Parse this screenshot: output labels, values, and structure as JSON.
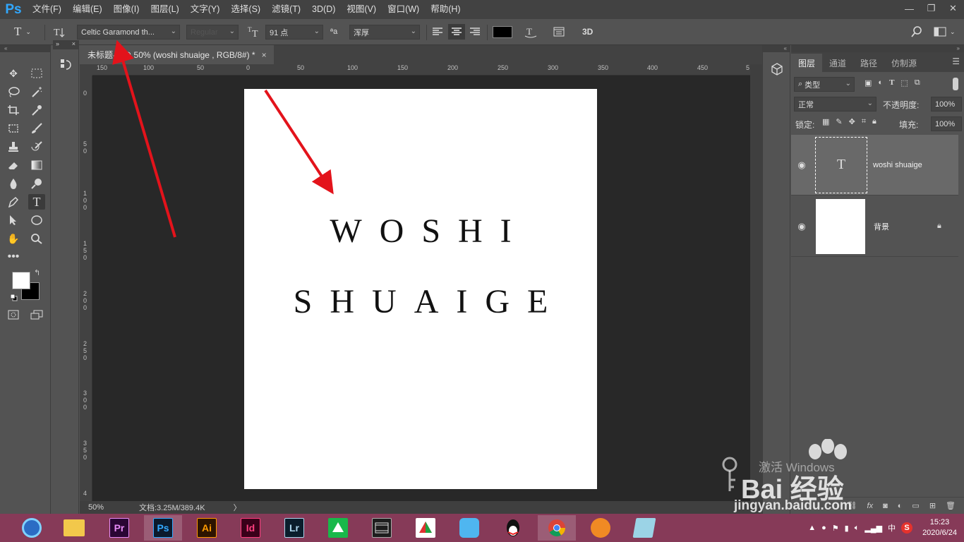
{
  "app": {
    "logo": "Ps"
  },
  "menu": [
    "文件(F)",
    "编辑(E)",
    "图像(I)",
    "图层(L)",
    "文字(Y)",
    "选择(S)",
    "滤镜(T)",
    "3D(D)",
    "视图(V)",
    "窗口(W)",
    "帮助(H)"
  ],
  "window_controls": {
    "minimize": "—",
    "restore": "❐",
    "close": "✕"
  },
  "options": {
    "tool_icon": "T",
    "font_family": "Celtic Garamond th...",
    "font_style": "Regular",
    "font_size": "91 点",
    "aa_label": "ªa",
    "antialias": "浑厚",
    "text_color": "#000000",
    "three_d": "3D"
  },
  "document": {
    "tab_title": "未标题-1 @ 50% (woshi shuaige , RGB/8#) *",
    "tab_close": "×",
    "line1": "WOSHI",
    "line2": "SHUAIGE",
    "zoom": "50%",
    "doc_info": "文档:3.25M/389.4K",
    "status_arrow": "〉"
  },
  "rulers": {
    "h_ticks": [
      "150",
      "50",
      "100",
      "50",
      "0",
      "50",
      "100",
      "150",
      "200",
      "250",
      "300",
      "350",
      "400",
      "450",
      "5"
    ],
    "v_ticks": [
      "0",
      "5 0",
      "1 0 0",
      "1 5 0",
      "2 0 0",
      "2 5 0",
      "3 0 0",
      "3 5 0",
      "4"
    ]
  },
  "swatches": {
    "foreground": "#ffffff",
    "background": "#000000"
  },
  "layers_panel": {
    "tabs": [
      "图层",
      "通道",
      "路径",
      "仿制源"
    ],
    "filter_kind": "类型",
    "blend_mode": "正常",
    "opacity_label": "不透明度:",
    "opacity_value": "100%",
    "lock_label": "锁定:",
    "fill_label": "填充:",
    "fill_value": "100%",
    "layers": [
      {
        "name": "woshi shuaige",
        "type": "text",
        "thumb_glyph": "T",
        "selected": true
      },
      {
        "name": "背景",
        "type": "background",
        "locked": true,
        "selected": false
      }
    ],
    "footer_icons": [
      "link-icon",
      "fx-icon",
      "mask-icon",
      "adjustment-icon",
      "folder-icon",
      "new-layer-icon",
      "trash-icon"
    ]
  },
  "watermark": {
    "activate": "激活 Windows",
    "brand": "Bai 经验",
    "url": "jingyan.baidu.com"
  },
  "taskbar": {
    "apps": [
      "Pr",
      "Ps",
      "Ai",
      "Id",
      "Lr"
    ],
    "time": "15:23",
    "date": "2020/6/24",
    "ime": "中",
    "sogou": "S"
  },
  "colors": {
    "menubar": "#424242",
    "panel": "#535353",
    "canvas_bg": "#282828",
    "arrow": "#e3131b",
    "taskbar": "#863a58",
    "ps_blue": "#31a8ff"
  }
}
